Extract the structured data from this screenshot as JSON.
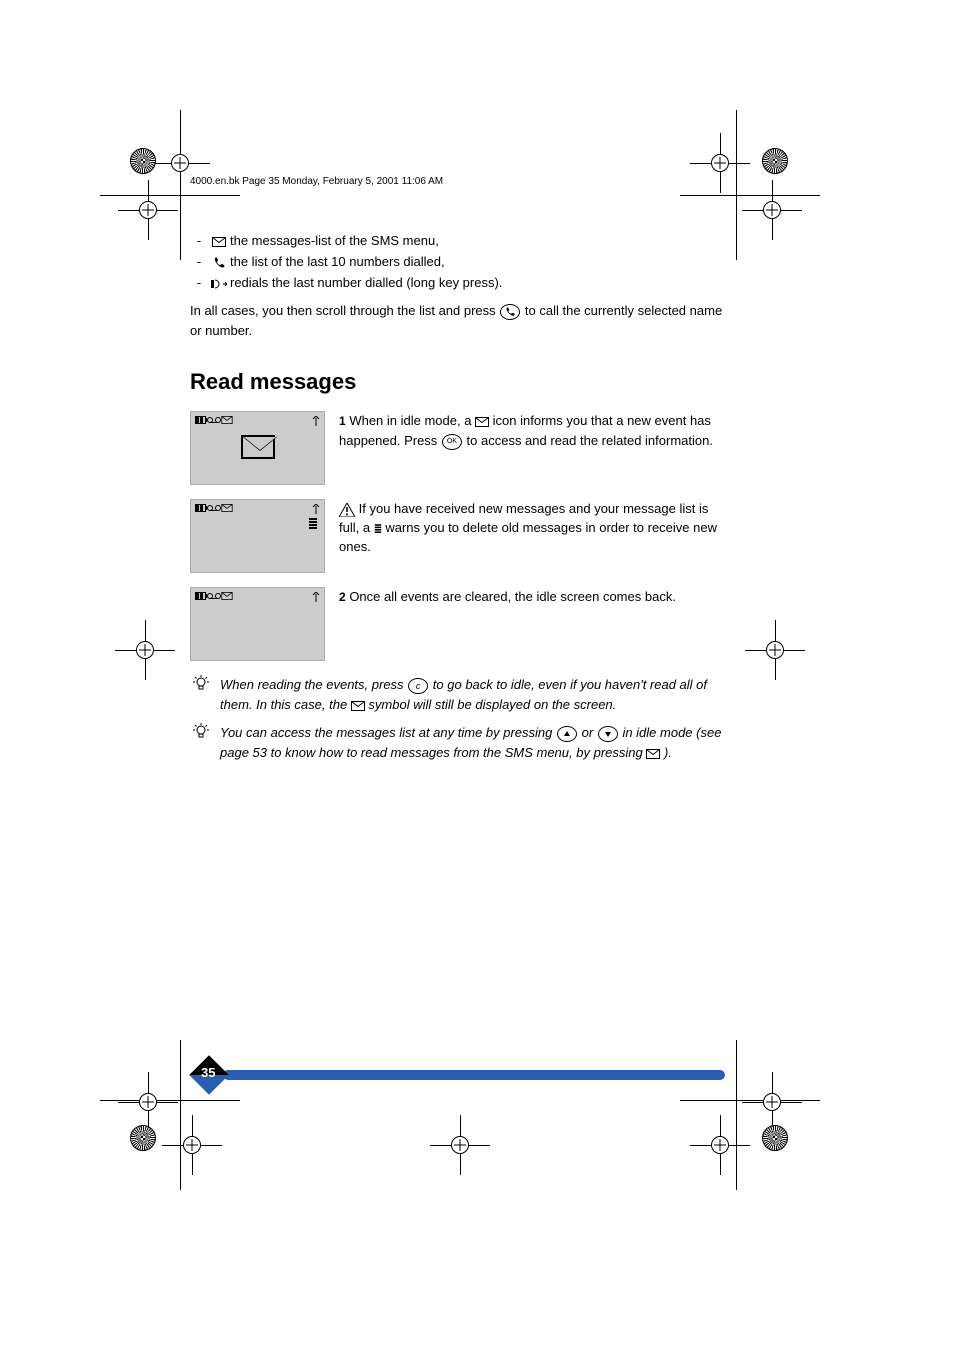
{
  "runner": "4000.en.bk  Page 35  Monday, February 5, 2001  11:06 AM",
  "icons": {
    "envelope_msg": "the messages-list of the SMS menu,",
    "phone_icon": "the list of the last 10 numbers dialled,",
    "redial_icon": "redials the last number dialled (long key press)."
  },
  "call_para_1": "In all cases, you then scroll through the list and press ",
  "call_key": " to call the currently selected name or number.",
  "heading": "Read messages",
  "row1": {
    "caption1": "When in idle mode, a ",
    "caption2": " icon informs you that a new event has happened. Press ",
    "caption3": " to access and read the related information.",
    "icon_label": "envelope icon",
    "ok_label": "OK"
  },
  "row2": {
    "warning_icon": "warning icon",
    "text1": "If you have received new messages and your message list is full, a ",
    "text2": " warns you to delete old messages in order to receive new ones."
  },
  "row3": {
    "text1": "Once all events are cleared, the idle screen comes back."
  },
  "tip1": {
    "text1": "When reading the events, press ",
    "text2": " to go back to idle, even if you haven't read all of them. In this case, the ",
    "text3": " symbol will still be displayed on the screen.",
    "c_key": "C"
  },
  "tip2": {
    "text1": "You can access the messages list at any time by pressing ",
    "text2": " or ",
    "text3": " in idle mode (see page 53 to know how to read messages from the SMS menu, by pressing ",
    "text4": ")."
  },
  "page_number": "35",
  "chart_data": null
}
